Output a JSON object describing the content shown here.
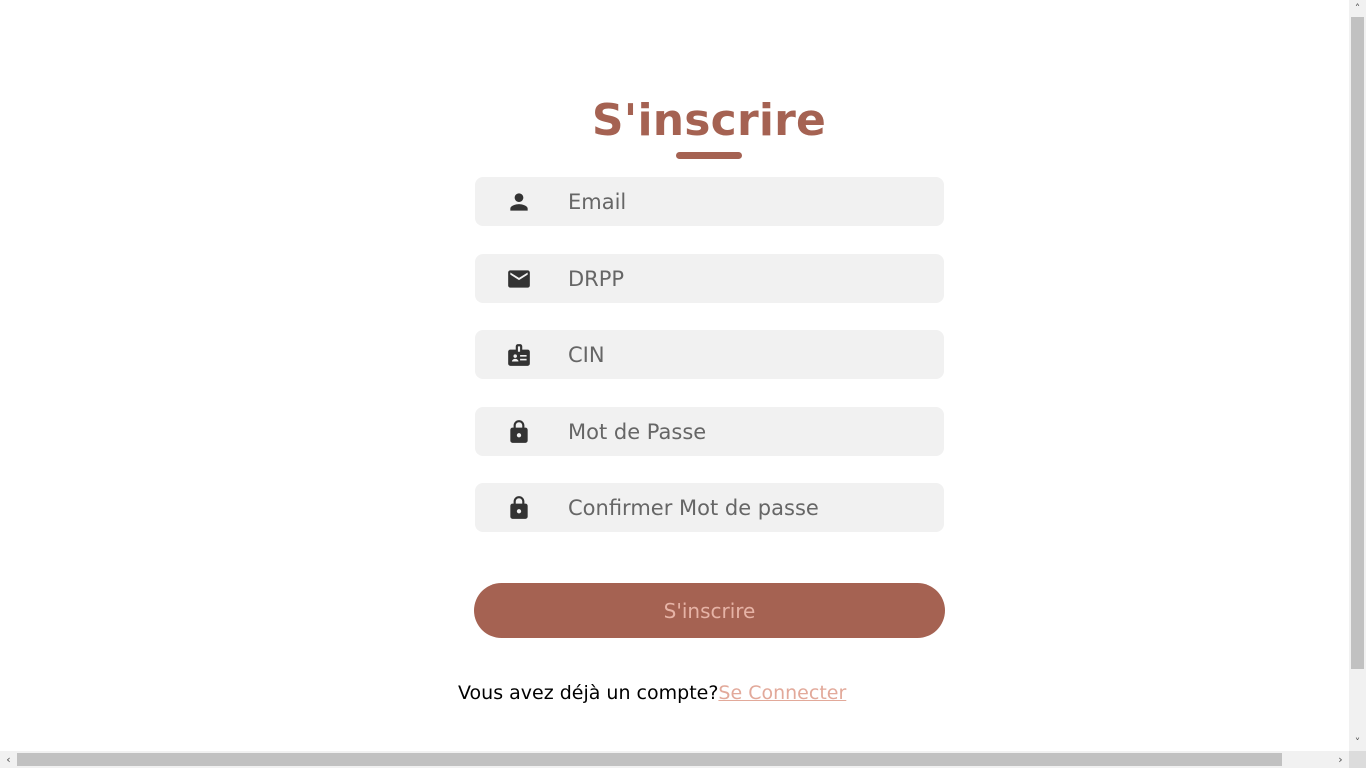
{
  "page": {
    "title": "S'inscrire"
  },
  "form": {
    "fields": [
      {
        "name": "email",
        "placeholder": "Email",
        "icon": "person-icon"
      },
      {
        "name": "drpp",
        "placeholder": "DRPP",
        "icon": "mail-icon"
      },
      {
        "name": "cin",
        "placeholder": "CIN",
        "icon": "id-badge-icon"
      },
      {
        "name": "password",
        "placeholder": "Mot de Passe",
        "icon": "lock-icon"
      },
      {
        "name": "confirm_password",
        "placeholder": "Confirmer Mot de passe",
        "icon": "lock-icon"
      }
    ],
    "submit_label": "S'inscrire"
  },
  "footer": {
    "prompt": "Vous avez déjà un compte?",
    "link_label": "Se Connecter"
  },
  "colors": {
    "accent": "#a56252",
    "field_bg": "#f1f1f1",
    "link": "#e2a99a",
    "button_text": "#e6b3a6"
  }
}
